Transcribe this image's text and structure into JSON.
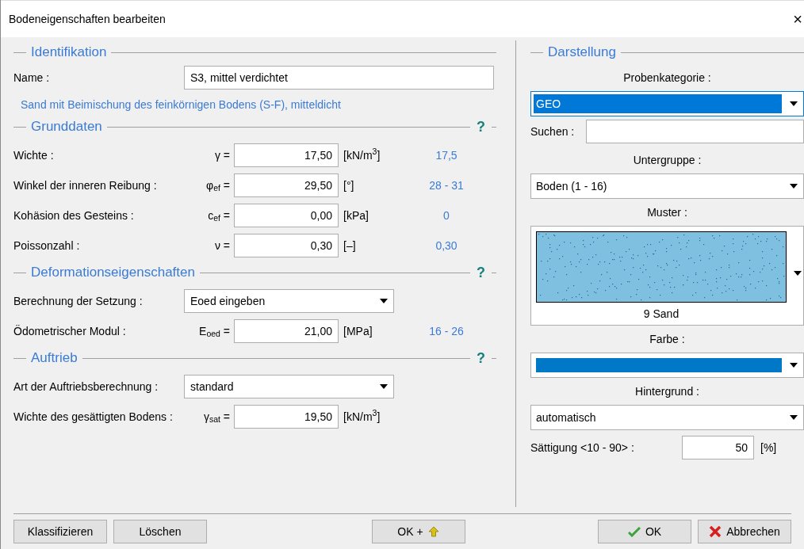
{
  "window": {
    "title": "Bodeneigenschaften bearbeiten",
    "close": "×"
  },
  "identification": {
    "heading": "Identifikation",
    "name_label": "Name :",
    "name_value": "S3, mittel verdichtet",
    "description": "Sand mit Beimischung des feinkörnigen Bodens (S-F), mitteldicht"
  },
  "sections": [
    {
      "heading": "Grunddaten",
      "help": "?",
      "rows": [
        {
          "kind": "number",
          "label": "Wichte :",
          "symbol": "γ =",
          "value": "17,50",
          "unit": "[kN/m$^{3}$]",
          "reference": "17,5"
        },
        {
          "kind": "number",
          "label": "Winkel der inneren Reibung :",
          "symbol": "φ$_{ef}$ =",
          "value": "29,50",
          "unit": "[°]",
          "reference": "28 - 31"
        },
        {
          "kind": "number",
          "label": "Kohäsion des Gesteins :",
          "symbol": "c$_{ef}$ =",
          "value": "0,00",
          "unit": "[kPa]",
          "reference": "0"
        },
        {
          "kind": "number",
          "label": "Poissonzahl :",
          "symbol": "ν =",
          "value": "0,30",
          "unit": "[–]",
          "reference": "0,30"
        }
      ]
    },
    {
      "heading": "Deformationseigenschaften",
      "help": "?",
      "rows": [
        {
          "kind": "select",
          "label": "Berechnung der Setzung :",
          "value": "Eoed eingeben"
        },
        {
          "kind": "number",
          "label": "Ödometrischer Modul :",
          "symbol": "E$_{oed}$ =",
          "value": "21,00",
          "unit": "[MPa]",
          "reference": "16 - 26"
        }
      ]
    },
    {
      "heading": "Auftrieb",
      "help": "?",
      "rows": [
        {
          "kind": "select",
          "label": "Art der Auftriebsberechnung :",
          "value": "standard"
        },
        {
          "kind": "number",
          "label": "Wichte des gesättigten Bodens :",
          "symbol": "γ$_{sat}$ =",
          "value": "19,50",
          "unit": "[kN/m$^{3}$]"
        }
      ]
    }
  ],
  "display": {
    "heading": "Darstellung",
    "items": [
      {
        "kind": "caption",
        "text": "Probenkategorie :"
      },
      {
        "kind": "select",
        "value": "GEO",
        "focused": true
      },
      {
        "kind": "search",
        "label": "Suchen :"
      },
      {
        "kind": "caption",
        "text": "Untergruppe :"
      },
      {
        "kind": "select",
        "value": "Boden (1 - 16)",
        "focused": false
      },
      {
        "kind": "caption",
        "text": "Muster :"
      },
      {
        "kind": "pattern",
        "name": "9 Sand",
        "color": "#7fbfe0"
      },
      {
        "kind": "caption",
        "text": "Farbe :"
      },
      {
        "kind": "color",
        "color": "#0078c8"
      },
      {
        "kind": "caption",
        "text": "Hintergrund :"
      },
      {
        "kind": "select",
        "value": "automatisch",
        "focused": false
      },
      {
        "kind": "number",
        "label": "Sättigung <10 - 90> :",
        "value": "50",
        "unit": "[%]"
      }
    ]
  },
  "left_buttons": [
    {
      "label": "Klassifizieren"
    },
    {
      "label": "Löschen"
    }
  ],
  "center_buttons": [
    {
      "label": "OK +",
      "kind": "ok-plus"
    }
  ],
  "right_buttons": [
    {
      "label": "OK",
      "kind": "ok"
    },
    {
      "label": "Abbrechen",
      "kind": "cancel"
    }
  ]
}
